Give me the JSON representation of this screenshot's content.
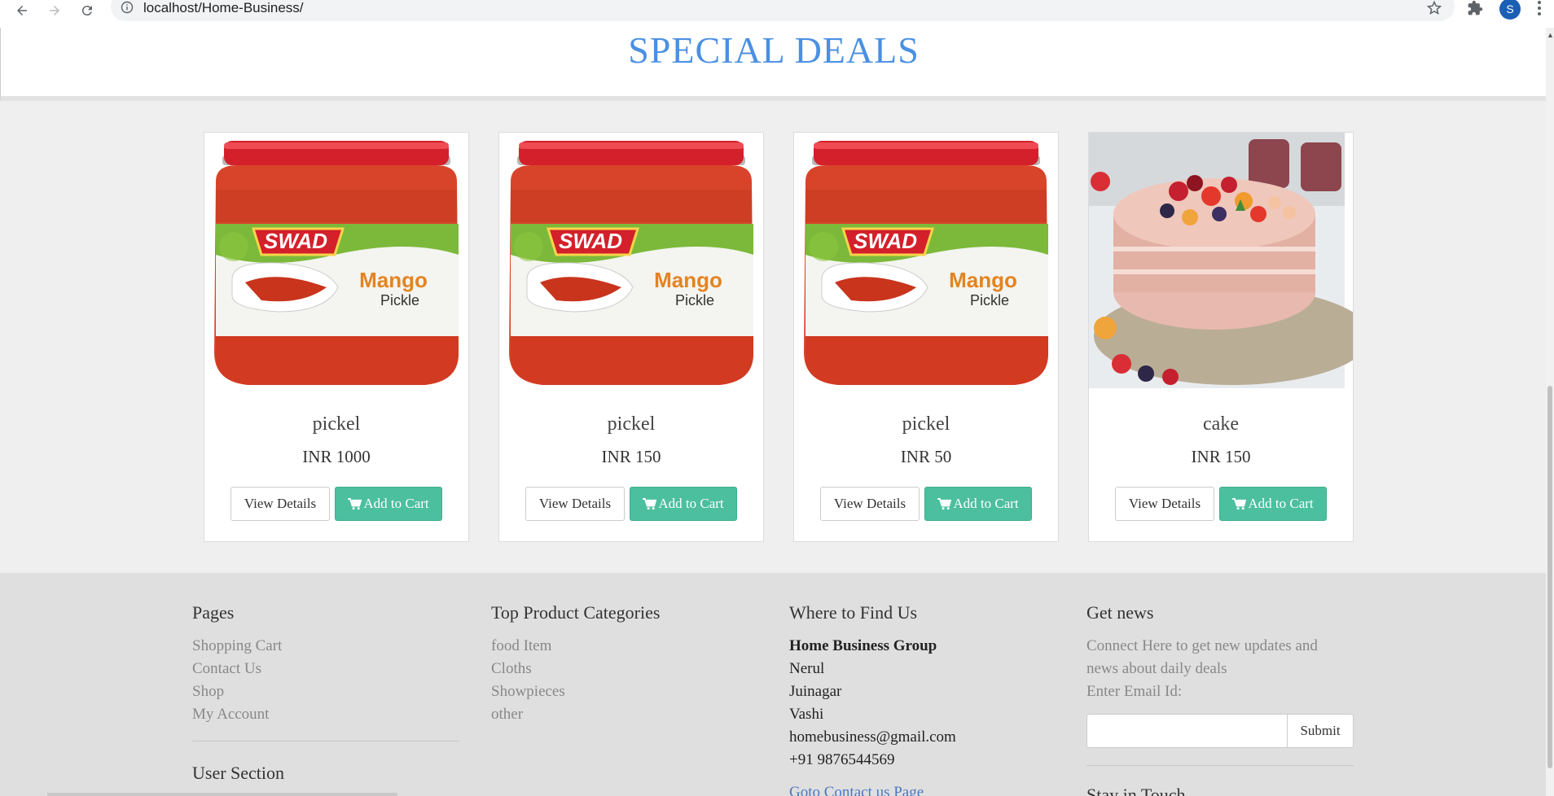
{
  "browser": {
    "url": "localhost/Home-Business/",
    "avatar_letter": "S"
  },
  "header": {
    "title": "SPECIAL DEALS"
  },
  "products": [
    {
      "name": "pickel",
      "price": "INR 1000",
      "image": "mango-pickle-jar",
      "brand": "SWAD",
      "product_text": "Mango",
      "product_sub": "Pickle"
    },
    {
      "name": "pickel",
      "price": "INR 150",
      "image": "mango-pickle-jar",
      "brand": "SWAD",
      "product_text": "Mango",
      "product_sub": "Pickle"
    },
    {
      "name": "pickel",
      "price": "INR 50",
      "image": "mango-pickle-jar",
      "brand": "SWAD",
      "product_text": "Mango",
      "product_sub": "Pickle"
    },
    {
      "name": "cake",
      "price": "INR 150",
      "image": "fruit-cake"
    }
  ],
  "buttons": {
    "view_details": "View Details",
    "add_to_cart": "Add to Cart"
  },
  "footer": {
    "pages": {
      "heading": "Pages",
      "links": [
        "Shopping Cart",
        "Contact Us",
        "Shop",
        "My Account"
      ],
      "user_section": "User Section"
    },
    "categories": {
      "heading": "Top Product Categories",
      "links": [
        "food Item",
        "Cloths",
        "Showpieces",
        "other"
      ]
    },
    "find_us": {
      "heading": "Where to Find Us",
      "company": "Home Business Group",
      "lines": [
        "Nerul",
        "Juinagar",
        "Vashi",
        "homebusiness@gmail.com",
        "+91 9876544569"
      ],
      "contact_link": "Goto Contact us Page"
    },
    "news": {
      "heading": "Get news",
      "description": "Connect Here to get new updates and news about daily deals",
      "email_label": "Enter Email Id:",
      "submit": "Submit",
      "stay_in_touch": "Stay in Touch"
    }
  },
  "colors": {
    "title": "#4a90e2",
    "cart_button": "#4cbf9f",
    "footer_bg": "#dfdfdf",
    "page_bg": "#efefef"
  }
}
